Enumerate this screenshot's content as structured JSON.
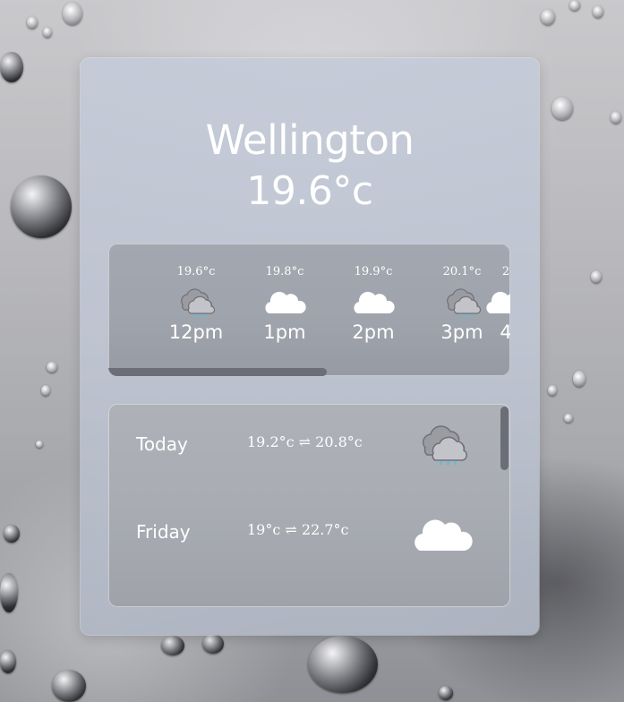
{
  "current": {
    "city": "Wellington",
    "temperature": "19.6°c"
  },
  "hourly": [
    {
      "temp": "19.6°c",
      "time": "12pm",
      "icon": "rain-cloud-icon"
    },
    {
      "temp": "19.8°c",
      "time": "1pm",
      "icon": "cloud-icon"
    },
    {
      "temp": "19.9°c",
      "time": "2pm",
      "icon": "cloud-icon"
    },
    {
      "temp": "20.1°c",
      "time": "3pm",
      "icon": "rain-cloud-icon"
    },
    {
      "temp": "2",
      "time": "4",
      "icon": "cloud-icon"
    }
  ],
  "daily": [
    {
      "day": "Today",
      "range": "19.2°c ⇌ 20.8°c",
      "icon": "rain-cloud-icon"
    },
    {
      "day": "Friday",
      "range": "19°c ⇌ 22.7°c",
      "icon": "cloud-icon"
    }
  ],
  "colors": {
    "text": "#ffffff",
    "rain_drops": "#4fc3d9",
    "scrollbar": "#6b6e76"
  }
}
